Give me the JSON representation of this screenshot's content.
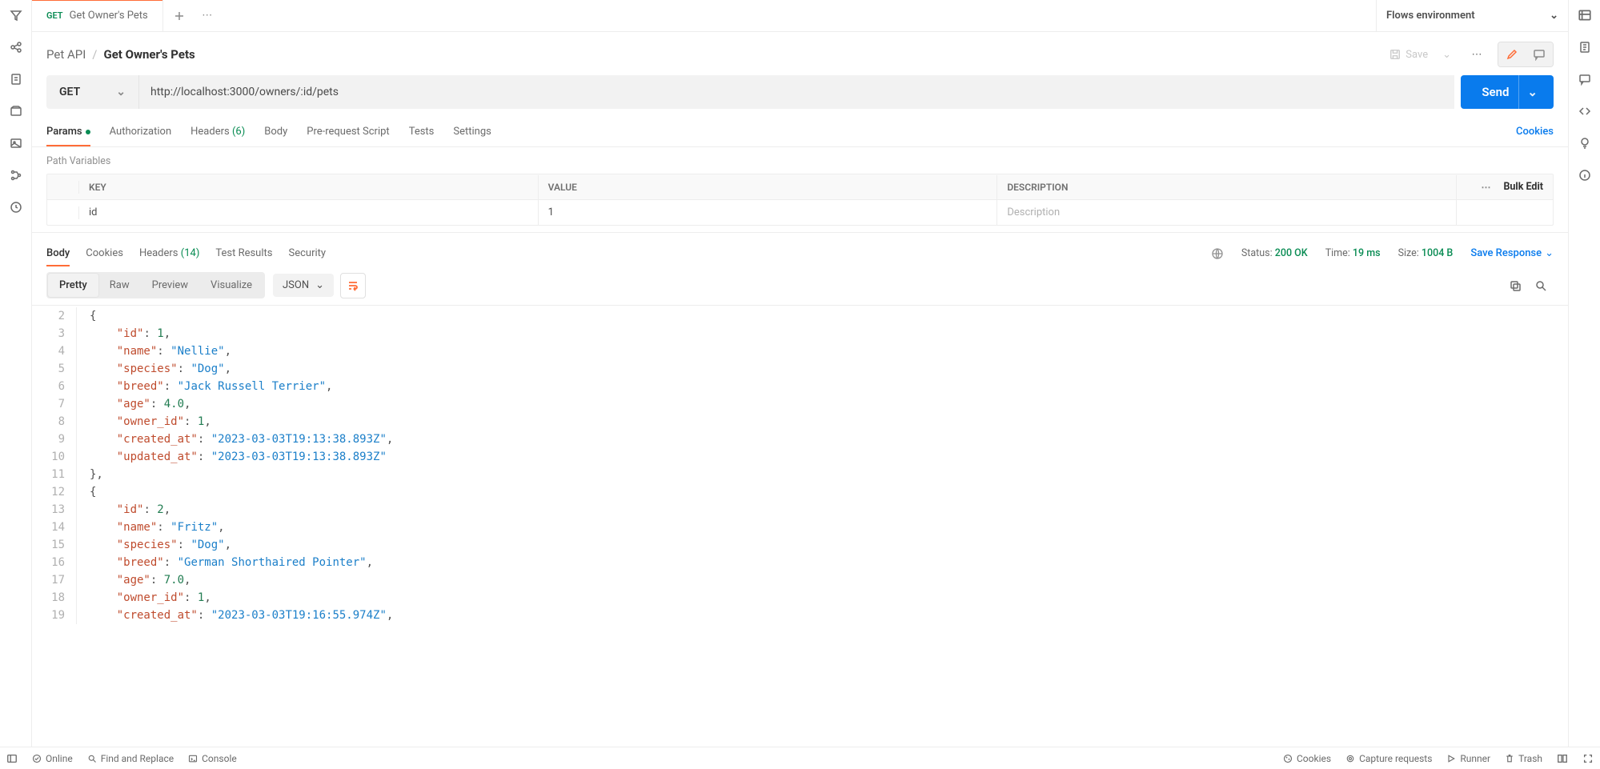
{
  "tab": {
    "method": "GET",
    "label": "Get Owner's Pets"
  },
  "env": {
    "name": "Flows environment"
  },
  "breadcrumb": {
    "collection": "Pet API",
    "sep": "/",
    "request": "Get Owner's Pets"
  },
  "header_actions": {
    "save_label": "Save"
  },
  "urlbar": {
    "method": "GET",
    "url": "http://localhost:3000/owners/:id/pets",
    "send": "Send"
  },
  "req_tabs": {
    "params": "Params",
    "authorization": "Authorization",
    "headers": "Headers",
    "headers_count": "(6)",
    "body": "Body",
    "prerequest": "Pre-request Script",
    "tests": "Tests",
    "settings": "Settings",
    "cookies": "Cookies"
  },
  "path_vars": {
    "title": "Path Variables",
    "head_key": "KEY",
    "head_value": "VALUE",
    "head_desc": "DESCRIPTION",
    "bulk_edit": "Bulk Edit",
    "row": {
      "key": "id",
      "value": "1",
      "desc_placeholder": "Description"
    }
  },
  "resp": {
    "tabs": {
      "body": "Body",
      "cookies": "Cookies",
      "headers": "Headers",
      "headers_count": "(14)",
      "test_results": "Test Results",
      "security": "Security"
    },
    "status_label": "Status:",
    "status": "200 OK",
    "time_label": "Time:",
    "time": "19 ms",
    "size_label": "Size:",
    "size": "1004 B",
    "save_response": "Save Response",
    "view": {
      "pretty": "Pretty",
      "raw": "Raw",
      "preview": "Preview",
      "visualize": "Visualize"
    },
    "format": "JSON",
    "code_lines": [
      {
        "n": 2,
        "html": "<span class='p'>{</span>"
      },
      {
        "n": 3,
        "html": "    <span class='k'>\"id\"</span><span class='p'>: </span><span class='n'>1</span><span class='p'>,</span>"
      },
      {
        "n": 4,
        "html": "    <span class='k'>\"name\"</span><span class='p'>: </span><span class='s'>\"Nellie\"</span><span class='p'>,</span>"
      },
      {
        "n": 5,
        "html": "    <span class='k'>\"species\"</span><span class='p'>: </span><span class='s'>\"Dog\"</span><span class='p'>,</span>"
      },
      {
        "n": 6,
        "html": "    <span class='k'>\"breed\"</span><span class='p'>: </span><span class='s'>\"Jack Russell Terrier\"</span><span class='p'>,</span>"
      },
      {
        "n": 7,
        "html": "    <span class='k'>\"age\"</span><span class='p'>: </span><span class='n'>4.0</span><span class='p'>,</span>"
      },
      {
        "n": 8,
        "html": "    <span class='k'>\"owner_id\"</span><span class='p'>: </span><span class='n'>1</span><span class='p'>,</span>"
      },
      {
        "n": 9,
        "html": "    <span class='k'>\"created_at\"</span><span class='p'>: </span><span class='s'>\"2023-03-03T19:13:38.893Z\"</span><span class='p'>,</span>"
      },
      {
        "n": 10,
        "html": "    <span class='k'>\"updated_at\"</span><span class='p'>: </span><span class='s'>\"2023-03-03T19:13:38.893Z\"</span>"
      },
      {
        "n": 11,
        "html": "<span class='p'>},</span>"
      },
      {
        "n": 12,
        "html": "<span class='p'>{</span>"
      },
      {
        "n": 13,
        "html": "    <span class='k'>\"id\"</span><span class='p'>: </span><span class='n'>2</span><span class='p'>,</span>"
      },
      {
        "n": 14,
        "html": "    <span class='k'>\"name\"</span><span class='p'>: </span><span class='s'>\"Fritz\"</span><span class='p'>,</span>"
      },
      {
        "n": 15,
        "html": "    <span class='k'>\"species\"</span><span class='p'>: </span><span class='s'>\"Dog\"</span><span class='p'>,</span>"
      },
      {
        "n": 16,
        "html": "    <span class='k'>\"breed\"</span><span class='p'>: </span><span class='s'>\"German Shorthaired Pointer\"</span><span class='p'>,</span>"
      },
      {
        "n": 17,
        "html": "    <span class='k'>\"age\"</span><span class='p'>: </span><span class='n'>7.0</span><span class='p'>,</span>"
      },
      {
        "n": 18,
        "html": "    <span class='k'>\"owner_id\"</span><span class='p'>: </span><span class='n'>1</span><span class='p'>,</span>"
      },
      {
        "n": 19,
        "html": "    <span class='k'>\"created_at\"</span><span class='p'>: </span><span class='s'>\"2023-03-03T19:16:55.974Z\"</span><span class='p'>,</span>"
      }
    ]
  },
  "footer": {
    "online": "Online",
    "find": "Find and Replace",
    "console": "Console",
    "cookies": "Cookies",
    "capture": "Capture requests",
    "runner": "Runner",
    "trash": "Trash"
  }
}
